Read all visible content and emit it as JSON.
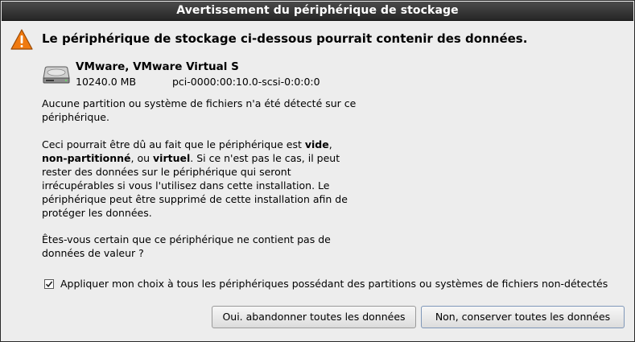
{
  "window": {
    "title": "Avertissement du périphérique de stockage"
  },
  "message": {
    "heading": "Le périphérique de stockage ci-dessous pourrait contenir des données."
  },
  "device": {
    "name": "VMware, VMware Virtual S",
    "size": "10240.0 MB",
    "path": "pci-0000:00:10.0-scsi-0:0:0:0",
    "icon": "hard-disk-icon"
  },
  "paragraphs": {
    "p1": "Aucune partition ou système de fichiers n'a été détecté sur ce périphérique.",
    "p2_a": "Ceci pourrait être dû au fait que le périphérique est ",
    "p2_vide": "vide",
    "p2_b": ",",
    "p2_nonpart": "non-partitionné",
    "p2_c": ", ou ",
    "p2_virtuel": "virtuel",
    "p2_d": ". Si ce n'est pas le cas, il peut rester des données sur le périphérique qui seront irrécupérables si vous l'utilisez dans cette installation. Le périphérique peut être supprimé de cette installation afin de protéger les données.",
    "p3": "Êtes-vous certain que ce périphérique ne contient pas de données de valeur ?"
  },
  "apply_all": {
    "label": "Appliquer mon choix à tous les périphériques possédant des partitions ou systèmes de fichiers non-détectés",
    "checked": true
  },
  "buttons": {
    "discard": "Oui. abandonner toutes les données",
    "keep": "Non, conserver toutes les données"
  },
  "colors": {
    "warning": "#f07a10",
    "titlebar": "#333333"
  }
}
